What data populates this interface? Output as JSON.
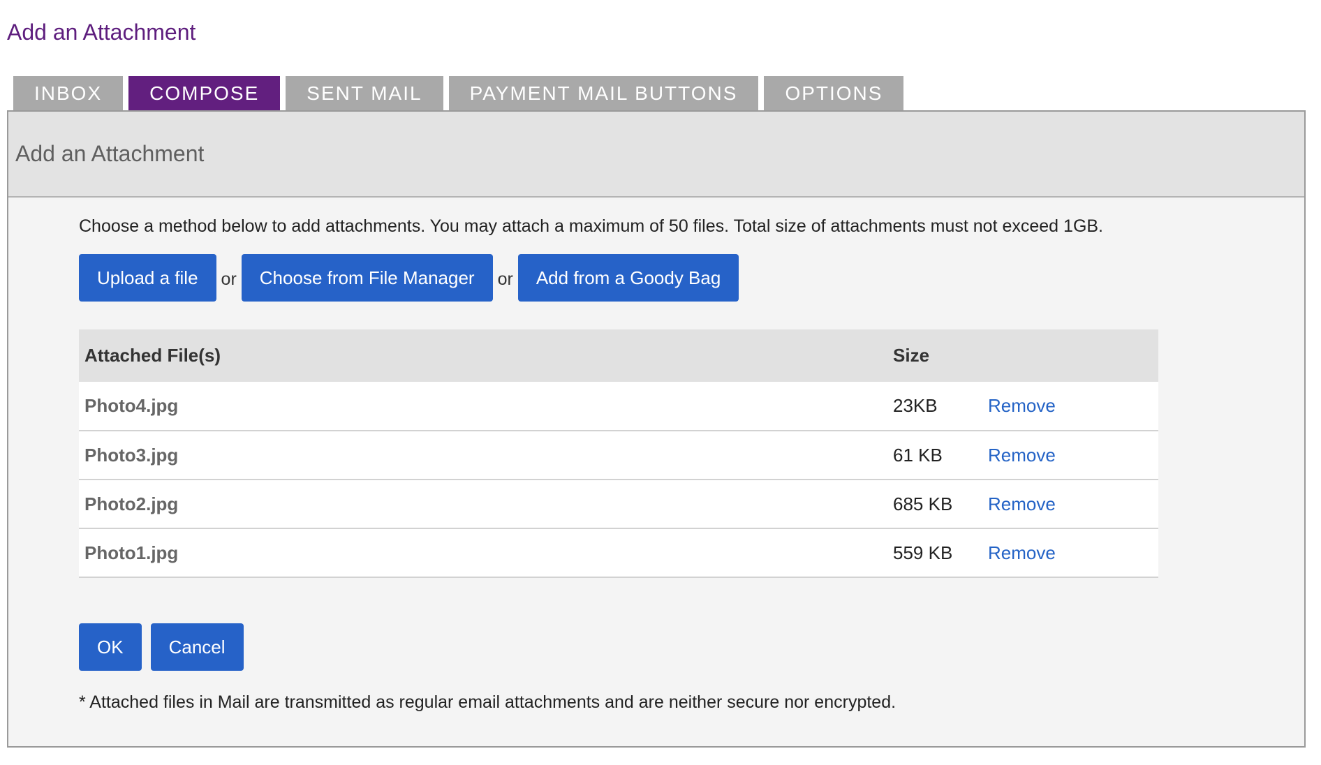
{
  "page": {
    "title": "Add an Attachment"
  },
  "tabs": [
    {
      "label": "INBOX",
      "active": false
    },
    {
      "label": "COMPOSE",
      "active": true
    },
    {
      "label": "SENT MAIL",
      "active": false
    },
    {
      "label": "PAYMENT MAIL BUTTONS",
      "active": false
    },
    {
      "label": "OPTIONS",
      "active": false
    }
  ],
  "panel": {
    "header": "Add an Attachment",
    "instructions": "Choose a method below to add attachments. You may attach a maximum of 50 files. Total size of attachments must not exceed 1GB.",
    "methods": {
      "upload": "Upload a file",
      "or1": "or",
      "file_manager": "Choose from File Manager",
      "or2": "or",
      "goody_bag": "Add from a Goody Bag"
    },
    "table": {
      "headers": {
        "file": "Attached File(s)",
        "size": "Size"
      },
      "rows": [
        {
          "name": "Photo4.jpg",
          "size": "23KB",
          "action": "Remove"
        },
        {
          "name": "Photo3.jpg",
          "size": "61 KB",
          "action": "Remove"
        },
        {
          "name": "Photo2.jpg",
          "size": "685 KB",
          "action": "Remove"
        },
        {
          "name": "Photo1.jpg",
          "size": "559 KB",
          "action": "Remove"
        }
      ]
    },
    "actions": {
      "ok": "OK",
      "cancel": "Cancel"
    },
    "footnote": "* Attached files in Mail are transmitted as regular email attachments and are neither secure nor encrypted."
  },
  "colors": {
    "brand_purple": "#621f7f",
    "tab_inactive": "#a9a9a9",
    "button_blue": "#2662c8",
    "link_blue": "#2463c6"
  }
}
